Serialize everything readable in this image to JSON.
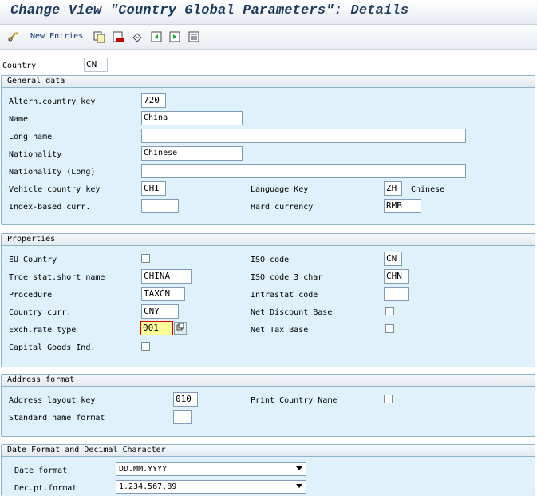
{
  "window": {
    "title": "Change View \"Country Global Parameters\": Details"
  },
  "toolbar": {
    "new_entries_label": "New Entries",
    "icons": [
      "glasses-icon",
      "copy-icon",
      "delete-icon",
      "undo-icon",
      "previous-entry-icon",
      "next-entry-icon",
      "variable-list-icon"
    ]
  },
  "header": {
    "country_label": "Country",
    "country_value": "CN"
  },
  "general": {
    "title": "General data",
    "altern_country_key_label": "Altern.country key",
    "altern_country_key_value": "720",
    "name_label": "Name",
    "name_value": "China",
    "long_name_label": "Long name",
    "long_name_value": "",
    "nationality_label": "Nationality",
    "nationality_value": "Chinese",
    "nationality_long_label": "Nationality (Long)",
    "nationality_long_value": "",
    "vehicle_country_key_label": "Vehicle country key",
    "vehicle_country_key_value": "CHI",
    "language_key_label": "Language Key",
    "language_key_value": "ZH",
    "language_key_text": "Chinese",
    "index_based_curr_label": "Index-based curr.",
    "index_based_curr_value": "",
    "hard_currency_label": "Hard currency",
    "hard_currency_value": "RMB"
  },
  "properties": {
    "title": "Properties",
    "eu_country_label": "EU Country",
    "eu_country_checked": false,
    "trde_stat_label": "Trde stat.short name",
    "trde_stat_value": "CHINA",
    "procedure_label": "Procedure",
    "procedure_value": "TAXCN",
    "country_curr_label": "Country curr.",
    "country_curr_value": "CNY",
    "exch_rate_type_label": "Exch.rate type",
    "exch_rate_type_value": "001",
    "capital_goods_label": "Capital Goods Ind.",
    "capital_goods_checked": false,
    "iso_code_label": "ISO code",
    "iso_code_value": "CN",
    "iso_code3_label": "ISO code 3 char",
    "iso_code3_value": "CHN",
    "intrastat_label": "Intrastat code",
    "intrastat_value": "",
    "net_discount_base_label": "Net Discount Base",
    "net_discount_base_checked": false,
    "net_tax_base_label": "Net Tax Base",
    "net_tax_base_checked": false
  },
  "address": {
    "title": "Address format",
    "layout_key_label": "Address layout key",
    "layout_key_value": "010",
    "std_name_format_label": "Standard name format",
    "std_name_format_value": "",
    "print_country_name_label": "Print Country Name",
    "print_country_name_checked": false
  },
  "datefmt": {
    "title": "Date Format and Decimal Character",
    "date_format_label": "Date format",
    "date_format_value": "DD.MM.YYYY",
    "dec_pt_format_label": "Dec.pt.format",
    "dec_pt_format_value": "1.234.567,89"
  }
}
